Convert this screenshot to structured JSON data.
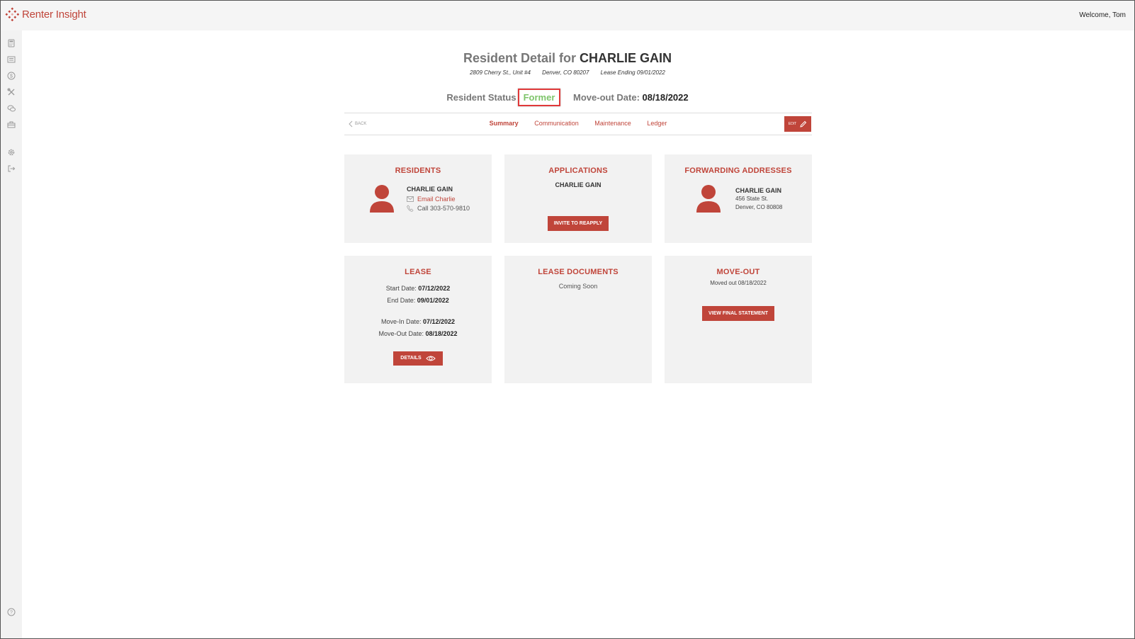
{
  "app": {
    "brand": "Renter Insight",
    "welcome": "Welcome, Tom"
  },
  "sidebar": {
    "icons": [
      "calculator-icon",
      "list-icon",
      "dollar-icon",
      "tools-icon",
      "chat-icon",
      "briefcase-icon",
      "gear-icon",
      "logout-icon",
      "help-icon"
    ]
  },
  "header": {
    "title_prefix": "Resident Detail for",
    "resident_name": "CHARLIE GAIN",
    "address": "2809 Cherry St., Unit #4",
    "city": "Denver, CO 80207",
    "lease_ending": "Lease Ending 09/01/2022",
    "status_label": "Resident Status",
    "status_value": "Former",
    "moveout_label": "Move-out Date:",
    "moveout_value": "08/18/2022"
  },
  "nav": {
    "back": "BACK",
    "tabs": [
      "Summary",
      "Communication",
      "Maintenance",
      "Ledger"
    ],
    "active_tab": "Summary",
    "edit": "EDIT"
  },
  "cards": {
    "residents": {
      "title": "RESIDENTS",
      "name": "CHARLIE GAIN",
      "email": "Email Charlie",
      "phone": "Call 303-570-9810"
    },
    "applications": {
      "title": "APPLICATIONS",
      "name": "CHARLIE GAIN",
      "button": "INVITE TO REAPPLY"
    },
    "forwarding": {
      "title": "FORWARDING ADDRESSES",
      "name": "CHARLIE GAIN",
      "street": "456 State St.",
      "city": "Denver, CO 80808"
    },
    "lease": {
      "title": "LEASE",
      "start_label": "Start Date:",
      "start": "07/12/2022",
      "end_label": "End Date:",
      "end": "09/01/2022",
      "movein_label": "Move-In Date:",
      "movein": "07/12/2022",
      "moveout_label": "Move-Out Date:",
      "moveout": "08/18/2022",
      "button": "DETAILS"
    },
    "documents": {
      "title": "LEASE DOCUMENTS",
      "text": "Coming Soon"
    },
    "moveout": {
      "title": "MOVE-OUT",
      "text": "Moved out 08/18/2022",
      "button": "VIEW FINAL STATEMENT"
    }
  },
  "colors": {
    "accent": "#c0453a",
    "status_green": "#7ec46a",
    "card_bg": "#f2f2f2"
  }
}
